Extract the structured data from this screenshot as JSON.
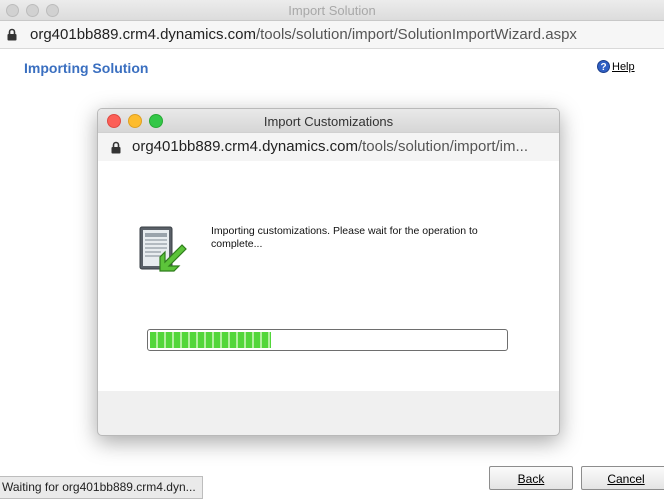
{
  "window": {
    "title": "Import Solution",
    "url_host": "org401bb889.crm4.dynamics.com",
    "url_path": "/tools/solution/import/SolutionImportWizard.aspx"
  },
  "page": {
    "title": "Importing Solution",
    "help_label": "Help",
    "help_icon": "?"
  },
  "dialog": {
    "title": "Import Customizations",
    "url_host": "org401bb889.crm4.dynamics.com",
    "url_path": "/tools/solution/import/im...",
    "message": "Importing customizations. Please wait for the operation to complete...",
    "icon": "import-customizations-icon",
    "progress": 0.34
  },
  "buttons": {
    "back": "Back",
    "cancel": "Cancel"
  },
  "status_bar": {
    "text": "Waiting for org401bb889.crm4.dyn..."
  },
  "colors": {
    "accent_title": "#3a6fc0",
    "progress_fill": "#52d63a"
  }
}
